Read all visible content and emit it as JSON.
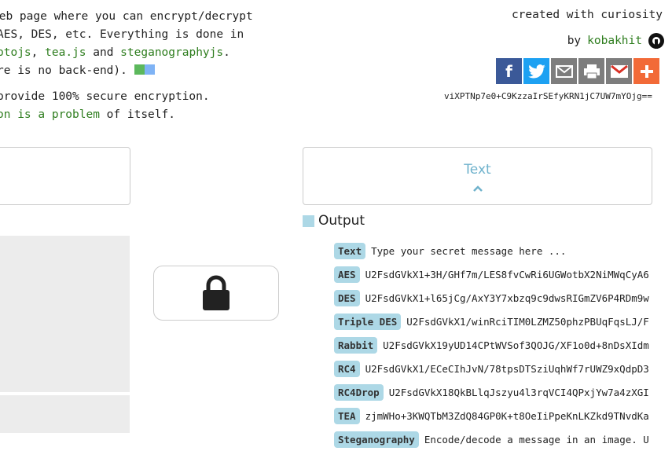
{
  "intro": {
    "line1": " web page where you can encrypt/decrypt",
    "line2": "AES, DES, etc. Everything is done in",
    "line3_link1": "ptojs",
    "line3_sep1": ", ",
    "line3_link2": "tea.js",
    "line3_sep2": " and ",
    "line3_link3": "steganographyjs",
    "line3_end": ".",
    "line4": "re is no back-end). ",
    "line5": "provide 100% secure encryption.",
    "line6_link": "on is a problem",
    "line6_end": " of itself."
  },
  "header": {
    "created": "created with curiosity",
    "by": "by",
    "author": "kobakhit"
  },
  "share": {
    "icons": [
      "facebook-icon",
      "twitter-icon",
      "email-icon",
      "print-icon",
      "gmail-icon",
      "plus-icon"
    ]
  },
  "hash": "viXPTNp7e0+C9KzzaIrSEfyKRN1jC7UW7mYOjg==",
  "text_panel": {
    "label": "Text",
    "chevron": "^"
  },
  "output": {
    "title": "Output",
    "rows": [
      {
        "tag": "Text",
        "value": "Type your secret message here ..."
      },
      {
        "tag": "AES",
        "value": "U2FsdGVkX1+3H/GHf7m/LES8fvCwRi6UGWotbX2NiMWqCyA6"
      },
      {
        "tag": "DES",
        "value": "U2FsdGVkX1+l65jCg/AxY3Y7xbzq9c9dwsRIGmZV6P4RDm9w"
      },
      {
        "tag": "Triple DES",
        "value": "U2FsdGVkX1/winRciTIM0LZMZ50phzPBUqFqsLJ/F"
      },
      {
        "tag": "Rabbit",
        "value": "U2FsdGVkX19yUD14CPtWVSof3QOJG/XF1o0d+8nDsXIdm"
      },
      {
        "tag": "RC4",
        "value": "U2FsdGVkX1/ECeCIhJvN/78tpsDTSziUqhWf7rUWZ9xQdpD3"
      },
      {
        "tag": "RC4Drop",
        "value": "U2FsdGVkX18QkBLlqJszyu4l3rqVCI4QPxjYw7a4zXGI"
      },
      {
        "tag": "TEA",
        "value": "zjmWHo+3KWQTbM3ZdQ84GP0K+t8OeIiPpeKnLKZkd9TNvdKa"
      },
      {
        "tag": "Steganography",
        "value": "Encode/decode a message in an image. U"
      }
    ]
  },
  "colors": {
    "link_green": "#2e7d1e",
    "tag_bg": "#add8e6",
    "panel_label": "#6fb2cc"
  }
}
